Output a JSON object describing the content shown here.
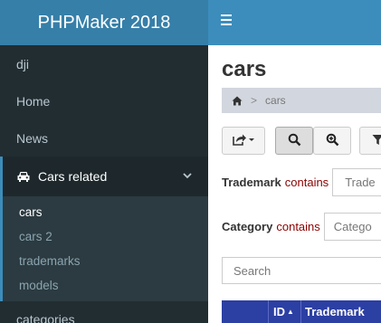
{
  "brand": "PHPMaker 2018",
  "sidebar": {
    "items": [
      {
        "label": "dji"
      },
      {
        "label": "Home"
      },
      {
        "label": "News"
      }
    ],
    "active_group": {
      "label": "Cars related",
      "icon": "car-icon",
      "chevron": "chevron-down-icon"
    },
    "subitems": [
      {
        "label": "cars"
      },
      {
        "label": "cars 2"
      },
      {
        "label": "trademarks"
      },
      {
        "label": "models"
      }
    ],
    "last_item": {
      "label": "categories"
    }
  },
  "header": {
    "menu_icon": "hamburger-icon"
  },
  "main": {
    "title": "cars",
    "breadcrumb": {
      "home_icon": "home-icon",
      "separator": ">",
      "current": "cars"
    },
    "toolbar": {
      "export_icon": "share-icon",
      "search_icon": "search-icon",
      "advanced_search_icon": "search-plus-icon",
      "filter_icon": "filter-icon"
    },
    "filters": [
      {
        "field": "Trademark",
        "operator": "contains",
        "placeholder": "Trade"
      },
      {
        "field": "Category",
        "operator": "contains",
        "placeholder": "Catego"
      }
    ],
    "search": {
      "placeholder": "Search"
    },
    "table": {
      "columns": [
        {
          "label": ""
        },
        {
          "label": "ID",
          "sort": "▲"
        },
        {
          "label": "Trademark"
        }
      ]
    }
  },
  "colors": {
    "brand_bg": "#367fa9",
    "header_bg": "#3c8dbc",
    "sidebar_bg": "#222d32",
    "table_header_bg": "#2c3fa3",
    "operator_text": "#8b0000"
  }
}
